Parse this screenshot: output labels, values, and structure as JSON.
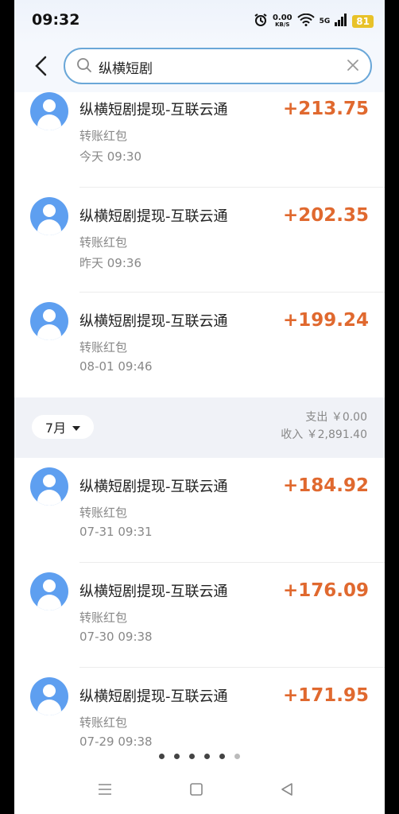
{
  "status": {
    "time": "09:32",
    "speed_value": "0.00",
    "speed_unit": "KB/S",
    "network": "5G",
    "battery": "81"
  },
  "search": {
    "query": "纵横短剧"
  },
  "transactions_top": [
    {
      "title": "纵横短剧提现-互联云通",
      "type": "转账红包",
      "date": "今天 09:30",
      "amount": "+213.75"
    },
    {
      "title": "纵横短剧提现-互联云通",
      "type": "转账红包",
      "date": "昨天 09:36",
      "amount": "+202.35"
    },
    {
      "title": "纵横短剧提现-互联云通",
      "type": "转账红包",
      "date": "08-01 09:46",
      "amount": "+199.24"
    }
  ],
  "month": {
    "label": "7月",
    "expense": "支出 ￥0.00",
    "income": "收入 ￥2,891.40"
  },
  "transactions_bottom": [
    {
      "title": "纵横短剧提现-互联云通",
      "type": "转账红包",
      "date": "07-31 09:31",
      "amount": "+184.92"
    },
    {
      "title": "纵横短剧提现-互联云通",
      "type": "转账红包",
      "date": "07-30 09:38",
      "amount": "+176.09"
    },
    {
      "title": "纵横短剧提现-互联云通",
      "type": "转账红包",
      "date": "07-29 09:38",
      "amount": "+171.95"
    }
  ],
  "colors": {
    "amount": "#e0692f",
    "avatar": "#5e9ff0",
    "search_border": "#6aa7d8"
  },
  "icons": [
    "alarm-icon",
    "wifi-icon",
    "signal-icon",
    "back-arrow-icon",
    "search-icon",
    "clear-icon",
    "chevron-down-icon",
    "menu-icon",
    "home-icon",
    "back-triangle-icon"
  ]
}
